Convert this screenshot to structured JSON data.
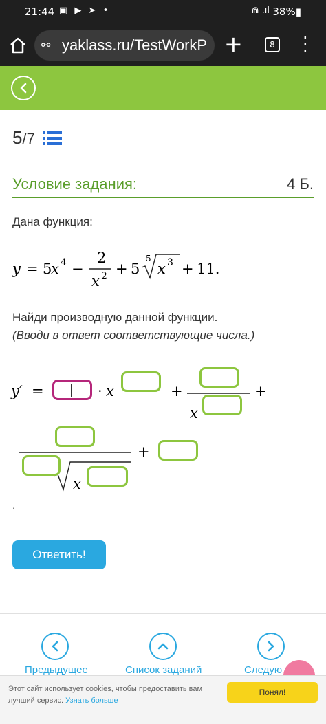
{
  "status_bar": {
    "time": "21:44",
    "left_icons": "▣ ▶ ➤ •",
    "signal": "⋒ .ıl",
    "battery": "38%▮"
  },
  "browser": {
    "url": "yaklass.ru/TestWorkP",
    "tab_count": "8"
  },
  "exercise": {
    "counter_current": "5",
    "counter_total": "/7",
    "condition_title": "Условие задания:",
    "points": "4 Б.",
    "given_text": "Дана функция:",
    "task_text": "Найди производную данной функции.",
    "task_hint": "(Вводи в ответ соответствующие числа.)",
    "formula": {
      "y": "y",
      "eq": "=",
      "c1": "5",
      "x": "x",
      "p1": "4",
      "minus": "−",
      "num": "2",
      "p2": "2",
      "plus": "+",
      "c3": "5",
      "root_index": "5",
      "p3": "3",
      "c4": "11."
    },
    "answer": {
      "lhs": "y′",
      "eq": "=",
      "dot": "·",
      "x": "x",
      "plus": "+"
    },
    "trailing_dot": ".",
    "submit_label": "Ответить!"
  },
  "nav": {
    "prev_label": "Предыдущее",
    "list_label": "Список заданий",
    "next_label": "Следую"
  },
  "cookie": {
    "text": "Этот сайт использует cookies, чтобы предоставить вам лучший сервис.",
    "link": "Узнать больше",
    "button": "Понял!"
  },
  "colors": {
    "brand_green": "#8dc63f",
    "link_blue": "#2aa8e0",
    "active_input": "#b5267a",
    "cookie_button": "#f7d31a"
  }
}
